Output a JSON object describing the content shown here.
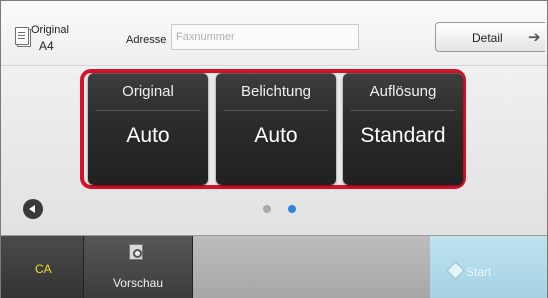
{
  "header": {
    "original_label": "Original",
    "original_size": "A4",
    "address_label": "Adresse",
    "fax_placeholder": "Faxnummer",
    "fax_value": "",
    "detail_label": "Detail"
  },
  "settings": [
    {
      "title": "Original",
      "value": "Auto"
    },
    {
      "title": "Belichtung",
      "value": "Auto"
    },
    {
      "title": "Auflösung",
      "value": "Standard"
    }
  ],
  "pager": {
    "pages": 2,
    "active_page": 2
  },
  "footer": {
    "ca_label": "CA",
    "preview_label": "Vorschau",
    "start_label": "Start"
  },
  "colors": {
    "highlight": "#d7112a",
    "ca_text": "#f2dc2a",
    "active_dot": "#2f86e0",
    "start_bg": "#b3dcea"
  }
}
